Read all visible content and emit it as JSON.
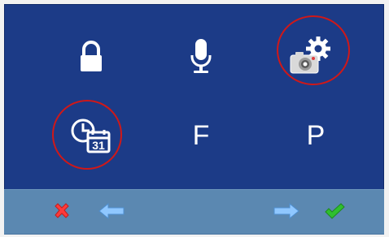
{
  "menu": {
    "items": [
      {
        "id": "lock",
        "icon": "lock-icon"
      },
      {
        "id": "mic",
        "icon": "microphone-icon"
      },
      {
        "id": "camera-settings",
        "icon": "camera-settings-icon",
        "highlighted": true
      },
      {
        "id": "schedule",
        "icon": "clock-calendar-icon",
        "calendar_day": "31",
        "highlighted": true
      },
      {
        "id": "f",
        "label": "F"
      },
      {
        "id": "p",
        "label": "P"
      }
    ]
  },
  "bottom_bar": {
    "buttons": [
      {
        "id": "cancel",
        "icon": "red-x-icon"
      },
      {
        "id": "back",
        "icon": "left-arrow-icon"
      },
      {
        "id": "forward",
        "icon": "right-arrow-icon"
      },
      {
        "id": "confirm",
        "icon": "green-check-icon"
      }
    ]
  },
  "colors": {
    "background": "#1c3b87",
    "bottom_bar": "#5b88b1",
    "highlight_circle": "#d01818",
    "arrow": "#8fc7ff",
    "check": "#2fbf2f",
    "cancel": "#ff3a3a"
  }
}
